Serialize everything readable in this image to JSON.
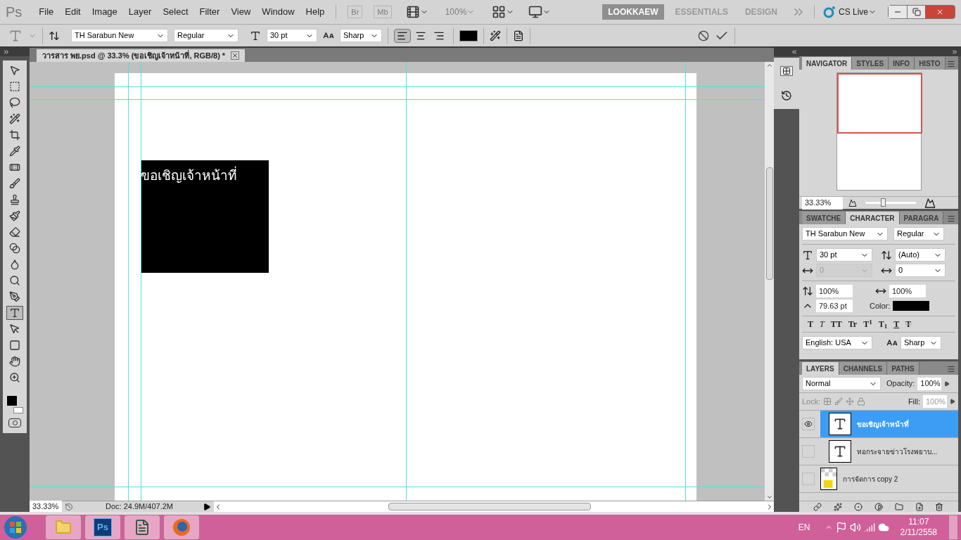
{
  "app_logo": "Ps",
  "menu": [
    "File",
    "Edit",
    "Image",
    "Layer",
    "Select",
    "Filter",
    "View",
    "Window",
    "Help"
  ],
  "app_bar": {
    "bridge": {
      "label": "Br",
      "disabled": true
    },
    "mini_bridge": {
      "label": "Mb",
      "disabled": true
    },
    "zoom": {
      "value": "100%",
      "disabled": true
    }
  },
  "workspaces": [
    {
      "label": "LOOKKAEW",
      "selected": true
    },
    {
      "label": "ESSENTIALS",
      "selected": false
    },
    {
      "label": "DESIGN",
      "selected": false
    }
  ],
  "cs_live": "CS Live",
  "options_bar": {
    "font_family": "TH Sarabun New",
    "font_style": "Regular",
    "font_size": "30 pt",
    "antialias": "Sharp",
    "alignment": [
      {
        "kind": "left",
        "selected": true
      },
      {
        "kind": "center",
        "selected": false
      },
      {
        "kind": "right",
        "selected": false
      }
    ]
  },
  "document_tab": {
    "title": "วารสาร พย.psd @ 33.3% (ขอเชิญเจ้าหน้าที่, RGB/8) *"
  },
  "tools": [
    {
      "kind": "move",
      "selected": false
    },
    {
      "kind": "marquee",
      "selected": false
    },
    {
      "kind": "lasso",
      "selected": false
    },
    {
      "kind": "wand",
      "selected": false
    },
    {
      "kind": "crop",
      "selected": false
    },
    {
      "kind": "eyedropper",
      "selected": false
    },
    {
      "kind": "heal",
      "selected": false
    },
    {
      "kind": "brush",
      "selected": false
    },
    {
      "kind": "stamp",
      "selected": false
    },
    {
      "kind": "history",
      "selected": false
    },
    {
      "kind": "eraser",
      "selected": false
    },
    {
      "kind": "gradient",
      "selected": false
    },
    {
      "kind": "blur",
      "selected": false
    },
    {
      "kind": "dodge",
      "selected": false
    },
    {
      "kind": "pen",
      "selected": false
    },
    {
      "kind": "type",
      "selected": true
    },
    {
      "kind": "path",
      "selected": false
    },
    {
      "kind": "shape",
      "selected": false
    },
    {
      "kind": "hand",
      "selected": false
    },
    {
      "kind": "zoom",
      "selected": false
    }
  ],
  "canvas": {
    "text": "ขอเชิญเจ้าหน้าที่"
  },
  "navigator": {
    "tabs": [
      {
        "label": "NAVIGATOR",
        "selected": true
      },
      {
        "label": "STYLES",
        "selected": false
      },
      {
        "label": "INFO",
        "selected": false
      },
      {
        "label": "HISTO",
        "selected": false
      }
    ],
    "zoom": "33.33%",
    "level": 0.35
  },
  "character": {
    "tabs": [
      {
        "label": "SWATCHE",
        "selected": false
      },
      {
        "label": "CHARACTER",
        "selected": true
      },
      {
        "label": "PARAGRA",
        "selected": false
      }
    ],
    "font_family": "TH Sarabun New",
    "font_style": "Regular",
    "size": "30 pt",
    "leading": "(Auto)",
    "kerning": {
      "value": "0",
      "disabled": true
    },
    "tracking": "0",
    "vertical_scale": "100%",
    "horizontal_scale": "100%",
    "baseline": "79.63 pt",
    "color_label": "Color:",
    "style_buttons": [
      {
        "label": "T",
        "kind": "bold"
      },
      {
        "label": "T",
        "kind": "italic"
      },
      {
        "label": "TT",
        "kind": "caps"
      },
      {
        "label": "Tr",
        "kind": "small"
      },
      {
        "label": "T$^{1}$",
        "kind": "super"
      },
      {
        "label": "T$_{1}$",
        "kind": "sub"
      },
      {
        "label": "T",
        "kind": "underline"
      },
      {
        "label": "T",
        "kind": "strike"
      }
    ],
    "language": "English: USA",
    "antialias": "Sharp"
  },
  "layers": {
    "tabs": [
      {
        "label": "LAYERS",
        "selected": true
      },
      {
        "label": "CHANNELS",
        "selected": false
      },
      {
        "label": "PATHS",
        "selected": false
      }
    ],
    "blend_mode": "Normal",
    "opacity_label": "Opacity:",
    "opacity": "100%",
    "lock_label": "Lock:",
    "fill_label": "Fill:",
    "fill": "100%",
    "items": [
      {
        "name": "ขอเชิญเจ้าหน้าที่",
        "kind": "text",
        "visible": true,
        "selected": true
      },
      {
        "name": "หอกระจายข่าวโรงพยาบ...",
        "kind": "text",
        "visible": false,
        "selected": false
      },
      {
        "name": "การจัดการ copy 2",
        "kind": "image",
        "visible": false,
        "selected": false
      }
    ]
  },
  "status_bar": {
    "zoom": "33.33%",
    "doc": "Doc: 24.9M/407.2M"
  },
  "taskbar": {
    "apps": [
      {
        "kind": "folder"
      },
      {
        "kind": "photoshop",
        "label": "Ps"
      },
      {
        "kind": "document"
      },
      {
        "kind": "browser"
      }
    ],
    "language": "EN",
    "time": "11:07",
    "date": "2/11/2558"
  }
}
